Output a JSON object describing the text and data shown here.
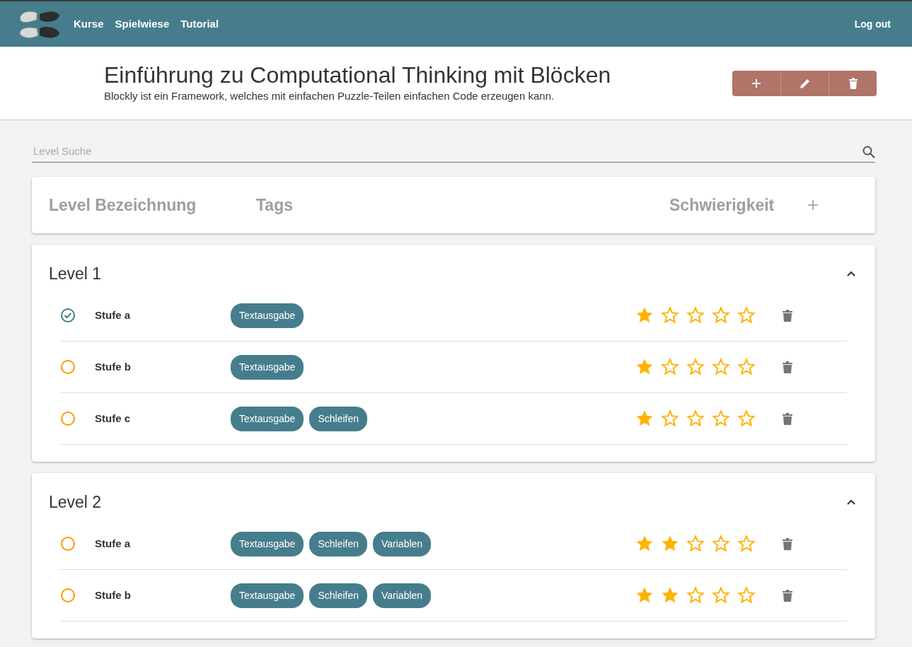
{
  "nav": {
    "links": [
      {
        "label": "Kurse"
      },
      {
        "label": "Spielwiese"
      },
      {
        "label": "Tutorial"
      }
    ],
    "logout": "Log out"
  },
  "course": {
    "title": "Einführung zu Computational Thinking mit Blöcken",
    "description": "Blockly ist ein Framework, welches mit einfachen Puzzle-Teilen einfachen Code erzeugen kann."
  },
  "search": {
    "placeholder": "Level Suche"
  },
  "table_header": {
    "columns": [
      "Level Bezeichnung",
      "Tags",
      "Schwierigkeit"
    ]
  },
  "levels": [
    {
      "title": "Level 1",
      "expanded": true,
      "stages": [
        {
          "name": "Stufe a",
          "done": true,
          "tags": [
            "Textausgabe"
          ],
          "stars": 1
        },
        {
          "name": "Stufe b",
          "done": false,
          "tags": [
            "Textausgabe"
          ],
          "stars": 1
        },
        {
          "name": "Stufe c",
          "done": false,
          "tags": [
            "Textausgabe",
            "Schleifen"
          ],
          "stars": 1
        }
      ]
    },
    {
      "title": "Level 2",
      "expanded": true,
      "stages": [
        {
          "name": "Stufe a",
          "done": false,
          "tags": [
            "Textausgabe",
            "Schleifen",
            "Variablen"
          ],
          "stars": 2
        },
        {
          "name": "Stufe b",
          "done": false,
          "tags": [
            "Textausgabe",
            "Schleifen",
            "Variablen"
          ],
          "stars": 2
        }
      ]
    }
  ]
}
